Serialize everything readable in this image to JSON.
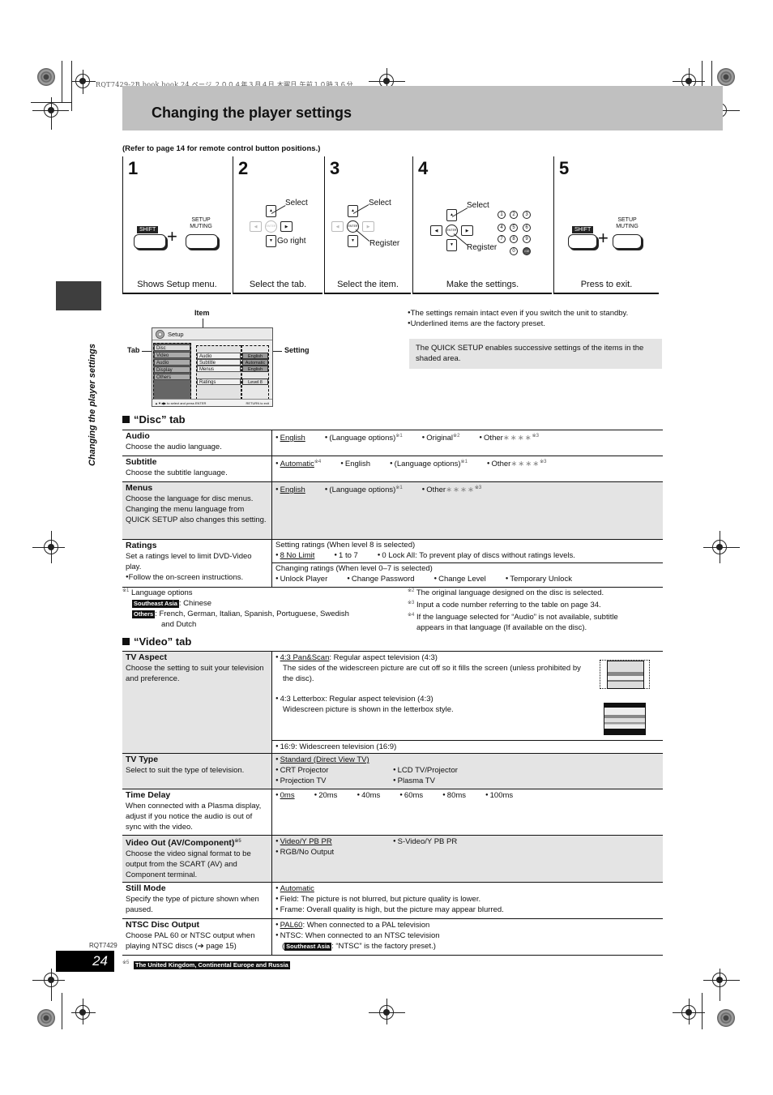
{
  "file_header": "RQT7429-2B book.book  24 ページ  ２００４年３月４日  木曜日  午前１０時３６分",
  "title": "Changing the player settings",
  "refer_note": "(Refer to page 14 for remote control button positions.)",
  "side_label": "Changing the player settings",
  "steps": [
    {
      "num": "1",
      "caption": "Shows Setup menu.",
      "shift": "SHIFT",
      "setup": "SETUP",
      "muting": "MUTING",
      "plus": "+"
    },
    {
      "num": "2",
      "caption": "Select the tab.",
      "label_a": "Select",
      "label_b": "Go right",
      "enter": "ENTER"
    },
    {
      "num": "3",
      "caption": "Select the item.",
      "label_a": "Select",
      "label_b": "Register",
      "enter": "ENTER"
    },
    {
      "num": "4",
      "caption": "Make the settings.",
      "label_a": "Select",
      "label_b": "Register",
      "enter": "ENTER",
      "digits": [
        "1",
        "2",
        "3",
        "4",
        "5",
        "6",
        "7",
        "8",
        "9",
        "0",
        ">10"
      ]
    },
    {
      "num": "5",
      "caption": "Press to exit.",
      "shift": "SHIFT",
      "setup": "SETUP",
      "muting": "MUTING",
      "plus": "+"
    }
  ],
  "osd": {
    "callout_item": "Item",
    "callout_tab": "Tab",
    "callout_setting": "Setting",
    "header": "Setup",
    "tabs": [
      "Disc",
      "Video",
      "Audio",
      "Display",
      "Others"
    ],
    "items": [
      "Audio",
      "Subtitle",
      "Menus",
      "Ratings"
    ],
    "settings": [
      "English",
      "Automatic",
      "English",
      "Level 8"
    ],
    "footer_left": "▲▼◀▶ to select and press ENTER",
    "footer_right": "RETURN to exit"
  },
  "notes": [
    "The settings remain intact even if you switch the unit to standby.",
    "Underlined items are the factory preset."
  ],
  "quick_setup_note": "The QUICK SETUP enables successive settings of the items in the shaded area.",
  "disc_tab": {
    "heading": "“Disc” tab",
    "rows": [
      {
        "name": "Audio",
        "desc": "Choose the audio language.",
        "options": [
          {
            "t": "English",
            "u": true
          },
          {
            "t": "(Language options)",
            "sup": "※1"
          },
          {
            "t": "Original",
            "sup": "※2"
          },
          {
            "t": "Other",
            "stars": "∗∗∗∗",
            "sup": "※3"
          }
        ]
      },
      {
        "name": "Subtitle",
        "desc": "Choose the subtitle language.",
        "options": [
          {
            "t": "Automatic",
            "u": true,
            "sup": "※4"
          },
          {
            "t": "English"
          },
          {
            "t": "(Language options)",
            "sup": "※1"
          },
          {
            "t": "Other",
            "stars": "∗∗∗∗",
            "sup": "※3"
          }
        ]
      },
      {
        "name": "Menus",
        "desc": "Choose the language for disc menus. Changing the menu language from QUICK SETUP also changes this setting.",
        "options": [
          {
            "t": "English",
            "u": true
          },
          {
            "t": "(Language options)",
            "sup": "※1"
          },
          {
            "t": "Other",
            "stars": "∗∗∗∗",
            "sup": "※3"
          }
        ]
      },
      {
        "name": "Ratings",
        "desc": "Set a ratings level to limit DVD-Video play.",
        "desc2": "Follow the on-screen instructions.",
        "sub1_title": "Setting ratings (When level 8 is selected)",
        "sub1_options": [
          {
            "t": "8 No Limit",
            "u": true
          },
          {
            "t": "1 to 7"
          },
          {
            "t": "0 Lock All: To prevent play of discs without ratings levels."
          }
        ],
        "sub2_title": "Changing ratings (When level 0–7 is selected)",
        "sub2_options": [
          {
            "t": "Unlock Player"
          },
          {
            "t": "Change Password"
          },
          {
            "t": "Change Level"
          },
          {
            "t": "Temporary Unlock"
          }
        ]
      }
    ],
    "footnotes": {
      "fn1_mark": "※1",
      "fn1_title": "Language options",
      "fn1_region1": "Southeast Asia",
      "fn1_region1_text": ": Chinese",
      "fn1_region2": "Others",
      "fn1_region2_text": ": French, German, Italian, Spanish, Portuguese, Swedish",
      "fn1_region2_text2": "and Dutch",
      "fn2": "The original language designed on the disc is selected.",
      "fn2_mark": "※2",
      "fn3": "Input a code number referring to the table on page 34.",
      "fn3_mark": "※3",
      "fn4": "If the language selected for “Audio” is not available, subtitle",
      "fn4b": "appears in that language (If available on the disc).",
      "fn4_mark": "※4"
    }
  },
  "video_tab": {
    "heading": "“Video” tab",
    "tv_aspect": {
      "name": "TV Aspect",
      "desc": "Choose the setting to suit your television and preference.",
      "opt1": "4:3 Pan&Scan",
      "opt1_rest": ":  Regular aspect television (4:3)",
      "opt1_desc": "The sides of the widescreen picture are cut off so it fills the screen (unless prohibited by the disc).",
      "opt2": "4:3 Letterbox:  Regular aspect television (4:3)",
      "opt2_desc": "Widescreen picture is shown in the letterbox style.",
      "opt3": "16:9:  Widescreen television (16:9)"
    },
    "tv_type": {
      "name": "TV Type",
      "desc": "Select to suit the type of television.",
      "opt_default": "Standard (Direct View TV)",
      "opts": [
        "CRT Projector",
        "LCD TV/Projector",
        "Projection TV",
        "Plasma TV"
      ]
    },
    "time_delay": {
      "name": "Time Delay",
      "desc": "When connected with a Plasma display, adjust if you notice the audio is out of sync with the video.",
      "opts": [
        {
          "t": "0ms",
          "u": true
        },
        {
          "t": "20ms"
        },
        {
          "t": "40ms"
        },
        {
          "t": "60ms"
        },
        {
          "t": "80ms"
        },
        {
          "t": "100ms"
        }
      ]
    },
    "video_out": {
      "name": "Video Out (AV/Component)",
      "sup": "※5",
      "desc": "Choose the video signal format to be output from the SCART (AV) and Component terminal.",
      "opts": [
        "Video/Y PB PR",
        "S-Video/Y PB PR",
        "RGB/No Output"
      ]
    },
    "still_mode": {
      "name": "Still Mode",
      "desc": "Specify the type of picture shown when paused.",
      "opt1": "Automatic",
      "opt2": "Field:    The picture is not blurred, but picture quality is lower.",
      "opt3": "Frame:  Overall quality is high, but the picture may appear blurred."
    },
    "ntsc": {
      "name": "NTSC Disc Output",
      "desc": "Choose PAL 60 or NTSC output when playing NTSC discs (➔ page 15)",
      "opt1": "PAL60",
      "opt1_rest": ":  When connected to a PAL television",
      "opt2": "NTSC:  When connected to an NTSC television",
      "opt3_pre": "(",
      "opt3_region": "Southeast Asia",
      "opt3_rest": ":  “NTSC” is the factory preset.)"
    },
    "fn5_mark": "※5",
    "fn5": "The United Kingdom, Continental Europe and Russia"
  },
  "page_code": "RQT7429",
  "page_number": "24"
}
